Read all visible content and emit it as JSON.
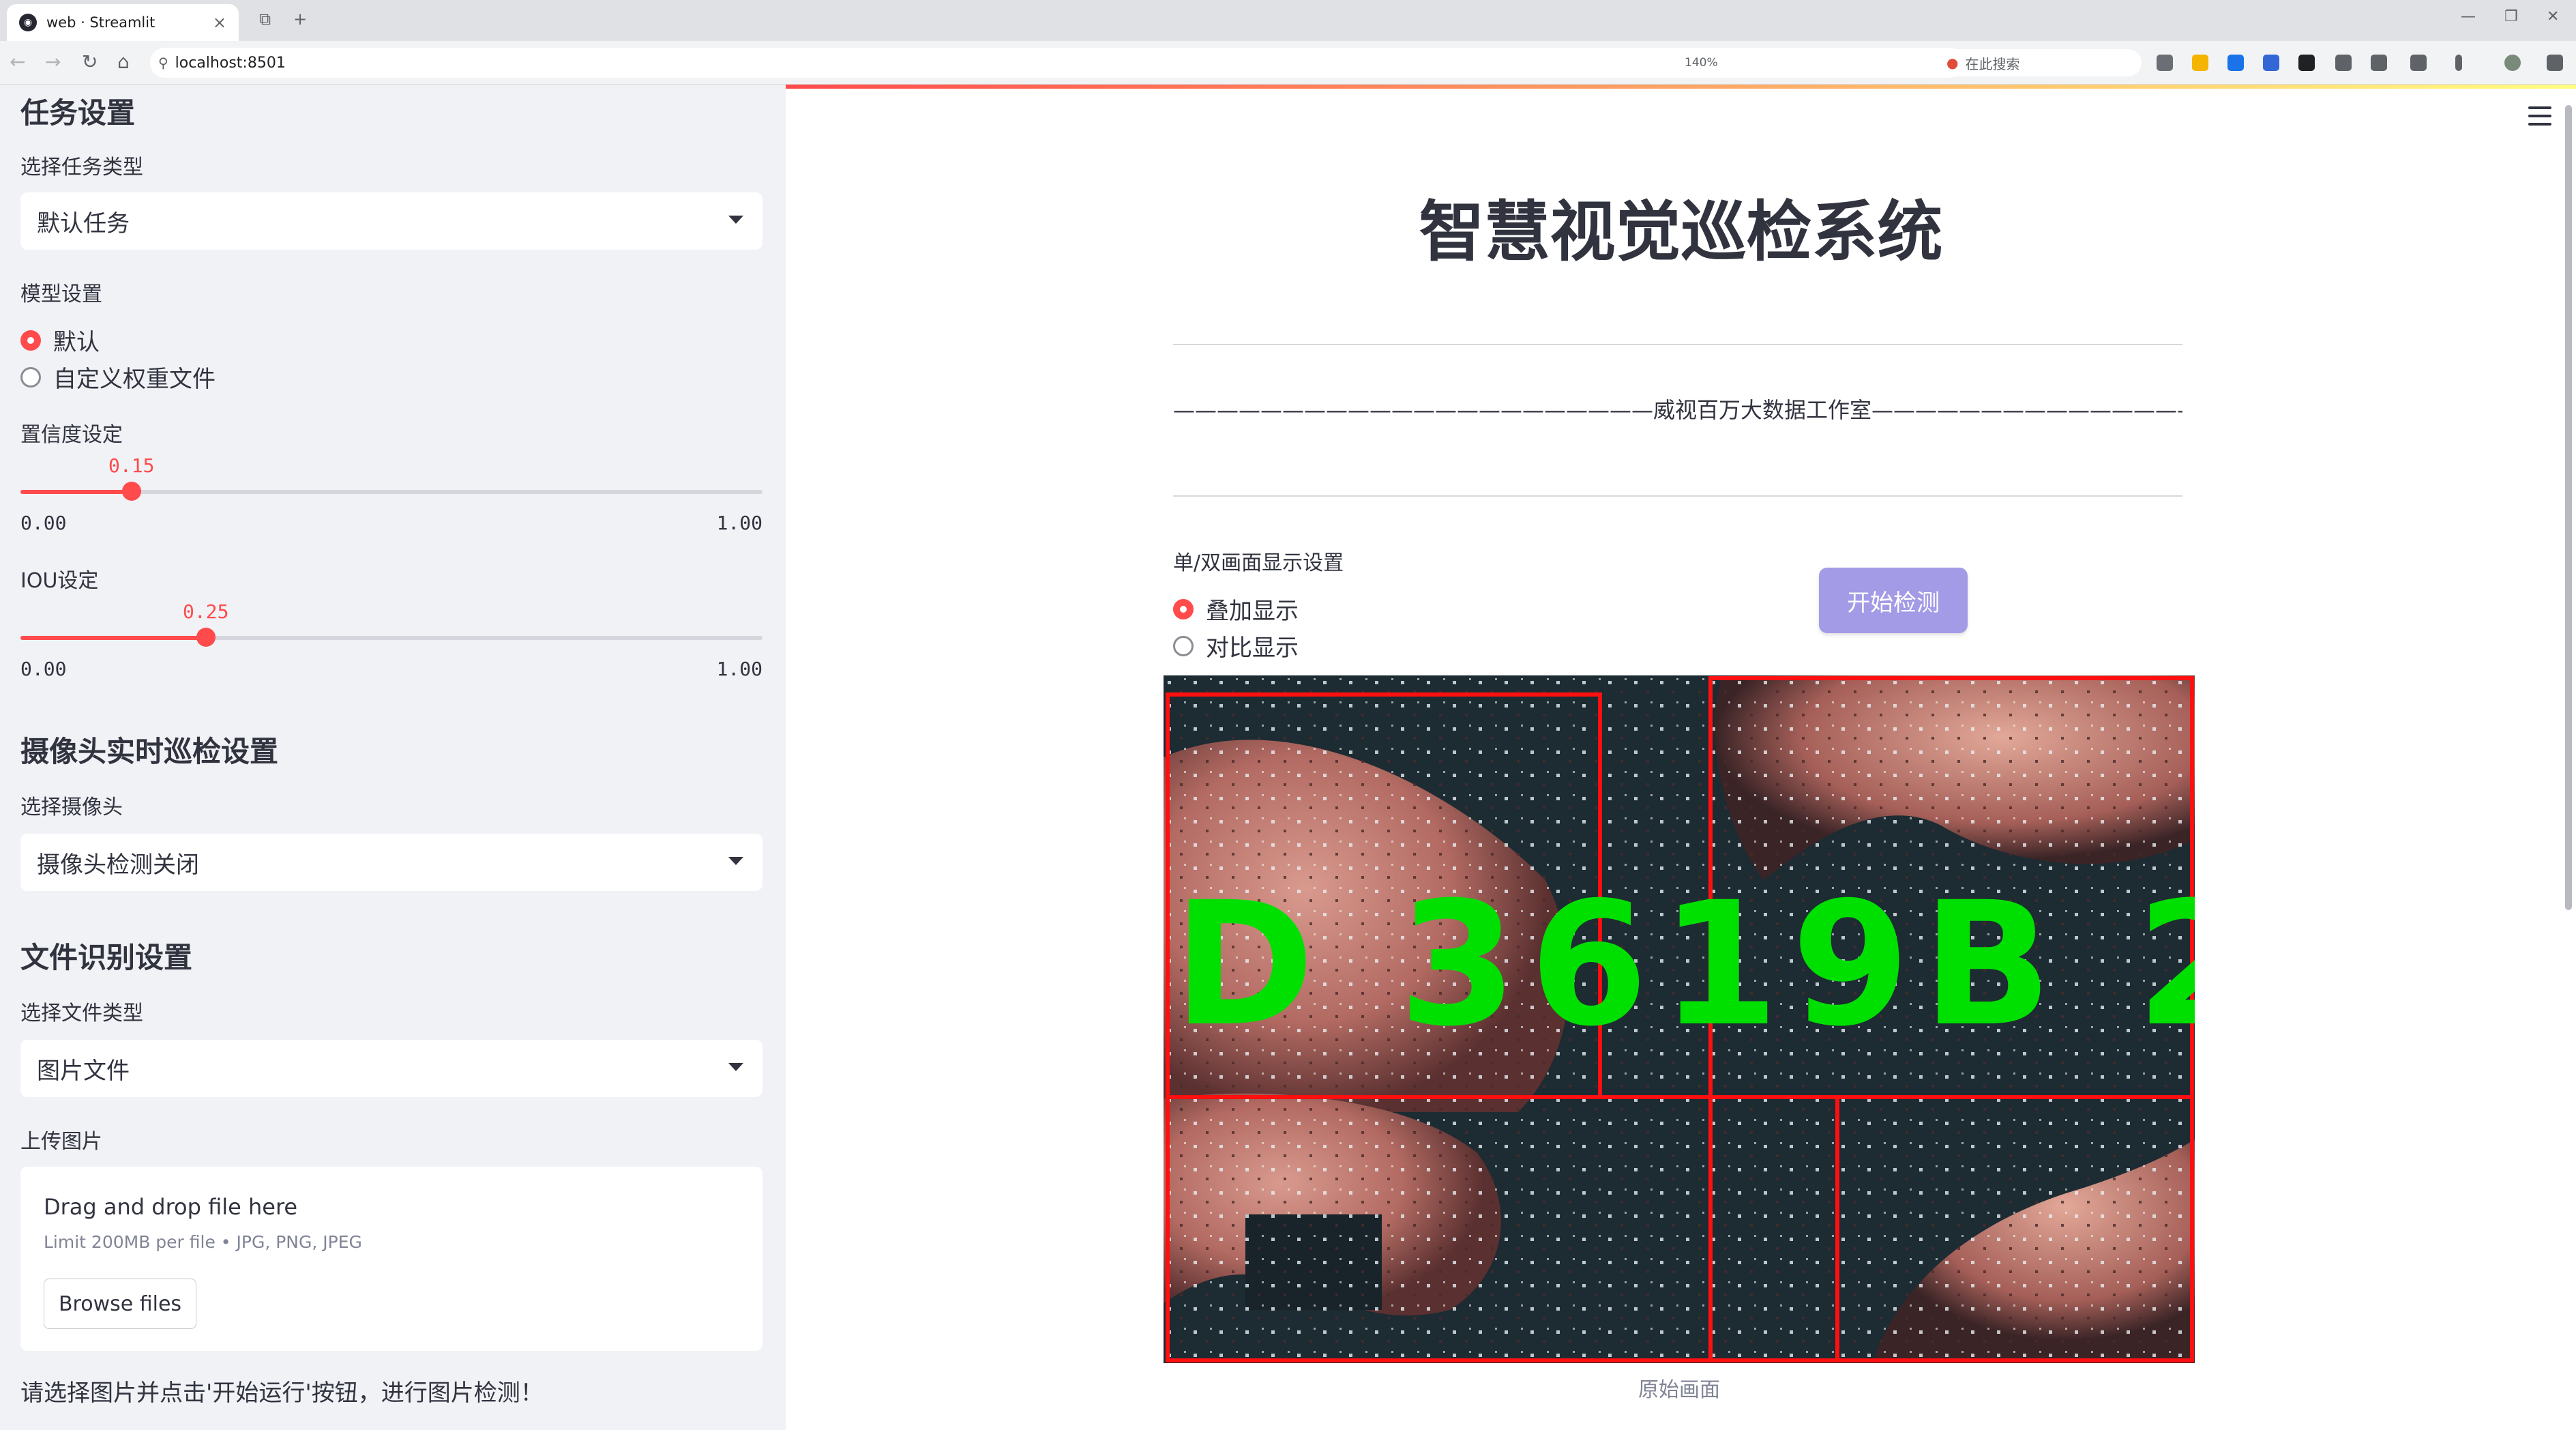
{
  "browser": {
    "tab_title": "web · Streamlit",
    "url": "localhost:8501",
    "zoom": "140%",
    "search_placeholder": "在此搜索"
  },
  "sidebar": {
    "task_header": "任务设置",
    "task_type_label": "选择任务类型",
    "task_type_value": "默认任务",
    "model_label": "模型设置",
    "model_options": [
      "默认",
      "自定义权重文件"
    ],
    "model_selected": "默认",
    "conf_label": "置信度设定",
    "conf_value": "0.15",
    "conf_min": "0.00",
    "conf_max": "1.00",
    "iou_label": "IOU设定",
    "iou_value": "0.25",
    "iou_min": "0.00",
    "iou_max": "1.00",
    "camera_header": "摄像头实时巡检设置",
    "camera_label": "选择摄像头",
    "camera_value": "摄像头检测关闭",
    "file_header": "文件识别设置",
    "file_type_label": "选择文件类型",
    "file_type_value": "图片文件",
    "upload_label": "上传图片",
    "upload_title": "Drag and drop file here",
    "upload_limit": "Limit 200MB per file • JPG, PNG, JPEG",
    "browse_label": "Browse files",
    "note": "请选择图片并点击'开始运行'按钮，进行图片检测！"
  },
  "main": {
    "title": "智慧视觉巡检系统",
    "studio_line": "——————————————————————威视百万大数据工作室————————————————————————",
    "display_label": "单/双画面显示设置",
    "display_options": [
      "叠加显示",
      "对比显示"
    ],
    "display_selected": "叠加显示",
    "start_button": "开始检测",
    "detection_text": "D 3619B 2",
    "caption": "原始画面"
  },
  "colors": {
    "accent": "#ff4b4b",
    "button": "#a39be6",
    "sidebar_bg": "#f0f2f6",
    "box_red": "#ff1010",
    "label_green": "#00e000"
  }
}
